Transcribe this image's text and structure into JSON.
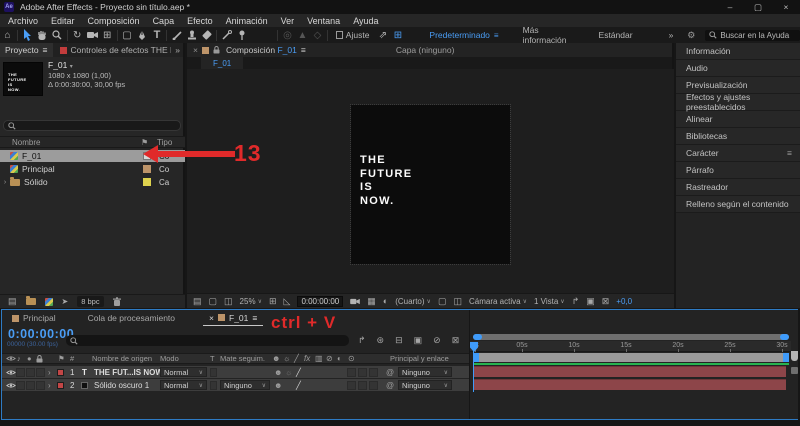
{
  "window": {
    "logo": "Ae",
    "title": "Adobe After Effects - Proyecto sin título.aep *",
    "minimize": "–",
    "maximize": "▢",
    "close": "×"
  },
  "menubar": {
    "items": [
      "Archivo",
      "Editar",
      "Composición",
      "Capa",
      "Efecto",
      "Animación",
      "Ver",
      "Ventana",
      "Ayuda"
    ]
  },
  "toolbar": {
    "snap_label": "Ajuste",
    "workspace_active": "Predeterminado",
    "workspace_more": "Más información",
    "workspace_standard": "Estándar",
    "help_search_placeholder": "Buscar en la Ayuda"
  },
  "project": {
    "tab": "Proyecto",
    "effects_tab": "Controles de efectos THE FUT",
    "preview": {
      "name": "F_01",
      "dims": "1080 x 1080 (1,00)",
      "duration": "Δ 0:00:30:00, 30,00 fps"
    },
    "columns": {
      "name": "Nombre",
      "type": "Tipo"
    },
    "rows": [
      {
        "name": "F_01",
        "type": "Co"
      },
      {
        "name": "Principal",
        "type": "Co"
      },
      {
        "name": "Sólido",
        "type": "Ca"
      }
    ],
    "label_colors": {
      "principal": "#bd9469",
      "solido": "#ded24e"
    },
    "depth": "8 bpc"
  },
  "comp": {
    "tab_label": "Composición",
    "tab_comp": "F_01",
    "tab_layer": "Capa (ninguno)",
    "viewer_tab": "F_01",
    "canvas": {
      "line1": "THE",
      "line2": "FUTURE",
      "line3": "IS",
      "line4": "NOW."
    },
    "status": {
      "zoom": "25%",
      "timecode": "0:00:00:00",
      "resolution": "(Cuarto)",
      "camera": "Cámara activa",
      "view": "1 Vista",
      "exposure": "+0,0"
    }
  },
  "dock": {
    "items": [
      "Información",
      "Audio",
      "Previsualización",
      "Efectos y ajustes preestablecidos",
      "Alinear",
      "Bibliotecas",
      "Carácter",
      "Párrafo",
      "Rastreador",
      "Relleno según el contenido"
    ],
    "active": "Carácter"
  },
  "timeline": {
    "tab_principal": "Principal",
    "tab_queue": "Cola de procesamiento",
    "tab_active": "F_01",
    "timecode": "0:00:00:00",
    "frames": "00000 (30.00 fps)",
    "header": {
      "source": "Nombre de origen",
      "mode": "Modo",
      "t": "T",
      "matte": "Mate seguim.",
      "parent": "Principal y enlace"
    },
    "layers": [
      {
        "num": "1",
        "badge": "T",
        "name": "THE FUT...IS NOW.",
        "mode": "Normal",
        "parent": "Ninguno"
      },
      {
        "num": "2",
        "badge": "",
        "name": "Sólido oscuro 1",
        "mode": "Normal",
        "matte": "Ninguno",
        "parent": "Ninguno"
      }
    ],
    "ticks": [
      "0s",
      "05s",
      "10s",
      "15s",
      "20s",
      "25s",
      "30s"
    ],
    "bar_color": "#8d4549"
  },
  "annotations": {
    "step": "13",
    "shortcut": "ctrl + V",
    "color": "#e02a2a"
  },
  "glyphs": {
    "menu": "≡",
    "overflow": "»",
    "chevron": "∨",
    "arrowdown": "▾",
    "expander": "›",
    "home": "⌂",
    "rotate": "↻",
    "hash": "#",
    "at": "@",
    "fx": "fx",
    "solo": "●",
    "note": "♪",
    "flag": "⚑",
    "shy": "☻",
    "sun": "☼",
    "slash": "╱",
    "blend": "▥",
    "blur": "⊘",
    "adj": "◐",
    "threed": "⊙",
    "film": "▤",
    "plane": "➤",
    "grid": "▦",
    "box": "▢",
    "split": "◫",
    "plus": "⊞",
    "corner": "◺",
    "target": "◎",
    "tri": "▲",
    "diam": "◇",
    "expand": "⇗",
    "crosshair": "⊞",
    "i1": "↱",
    "i2": "⊛",
    "i3": "⊟",
    "i4": "▣",
    "i5": "⊘",
    "i6": "⊠"
  }
}
